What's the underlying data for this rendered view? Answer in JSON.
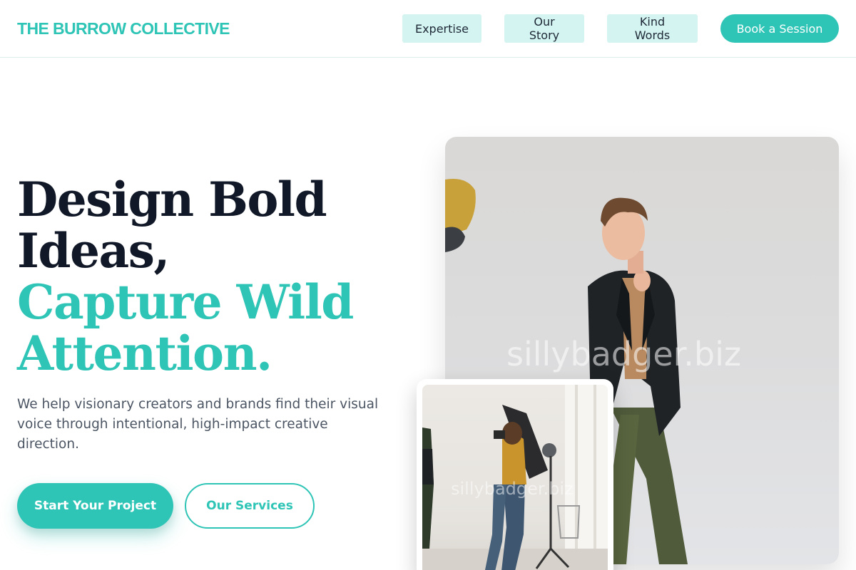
{
  "brand": {
    "name": "THE BURROW COLLECTIVE"
  },
  "nav": {
    "items": [
      {
        "label": "Expertise"
      },
      {
        "label": "Our Story"
      },
      {
        "label": "Kind Words"
      }
    ],
    "cta_label": "Book a Session"
  },
  "hero": {
    "headline_line1": "Design Bold",
    "headline_line2": "Ideas,",
    "headline_accent_line1": "Capture Wild",
    "headline_accent_line2": "Attention.",
    "subtext": "We help visionary creators and brands find their visual voice through intentional, high-impact creative direction.",
    "primary_button": "Start Your Project",
    "secondary_button": "Our Services"
  },
  "images": {
    "main_watermark": "sillybadger.biz",
    "inset_watermark": "sillybadger.biz"
  },
  "colors": {
    "accent": "#2ec4b6",
    "nav_pill_bg": "#d3f4f0",
    "heading_dark": "#111827",
    "body_text": "#4b5563"
  }
}
